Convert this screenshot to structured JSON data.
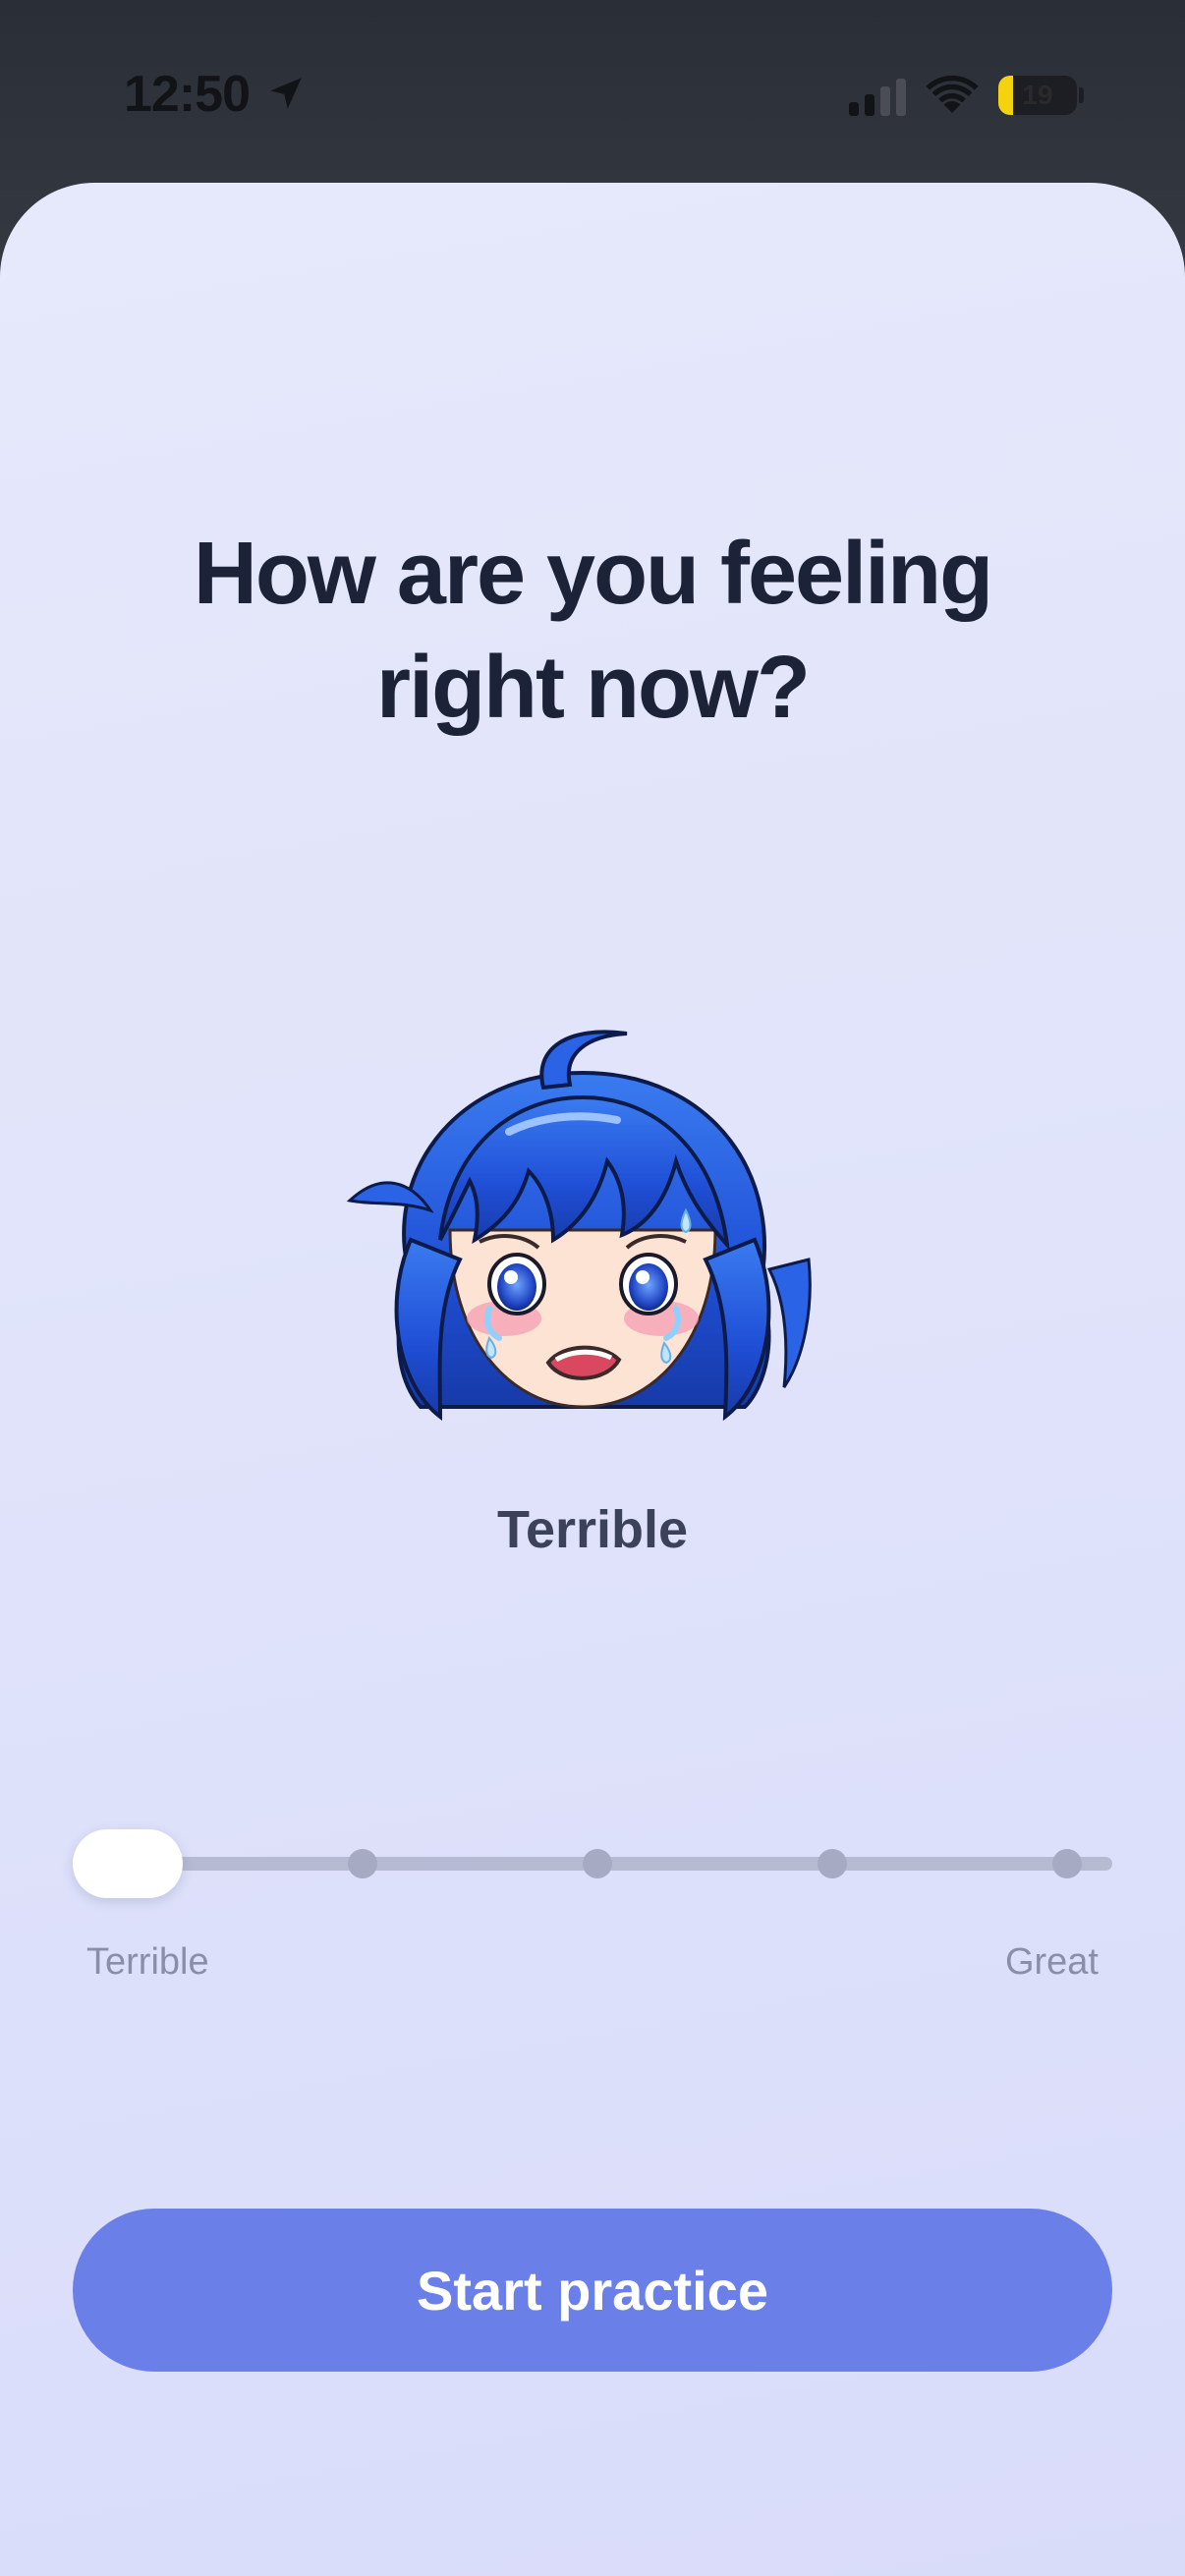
{
  "status_bar": {
    "time": "12:50",
    "battery_percent": "19",
    "battery_level": 0.19,
    "location_icon": "location-arrow-icon",
    "signal_icon": "cellular-signal-icon",
    "wifi_icon": "wifi-icon"
  },
  "mood_screen": {
    "title_line1": "How are you feeling",
    "title_line2": "right now?",
    "mascot": "crying-anime-girl-blue-hair",
    "mood_label": "Terrible",
    "slider": {
      "min_label": "Terrible",
      "max_label": "Great",
      "steps": 5,
      "selected_index": 0
    },
    "start_button_label": "Start practice"
  },
  "colors": {
    "accent": "#6b7fe8",
    "title_text": "#1c2238",
    "battery_yellow": "#f5d20f"
  }
}
